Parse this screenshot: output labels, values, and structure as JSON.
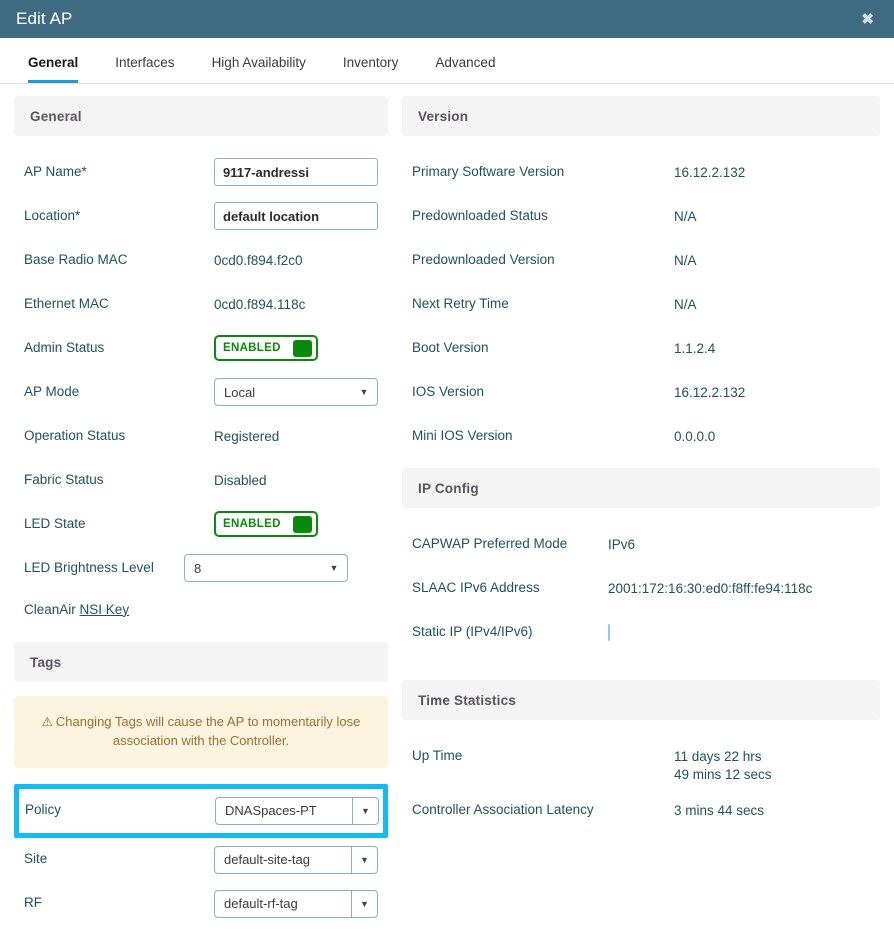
{
  "window": {
    "title": "Edit AP",
    "close_icon": "close-icon",
    "close_glyph": "✖"
  },
  "tabs": [
    {
      "label": "General",
      "active": true
    },
    {
      "label": "Interfaces",
      "active": false
    },
    {
      "label": "High Availability",
      "active": false
    },
    {
      "label": "Inventory",
      "active": false
    },
    {
      "label": "Advanced",
      "active": false
    }
  ],
  "colors": {
    "titlebar": "#3f6b82",
    "tab_active_underline": "#1b9bd8",
    "label_text": "#1f5260",
    "section_header_bg": "#f4f4f5",
    "toggle_green": "#0a8a0a",
    "highlight_cyan": "#11bdf0",
    "warning_bg": "#fdf4e0",
    "warning_text": "#9b7030"
  },
  "left": {
    "general": {
      "section_title": "General",
      "ap_name": {
        "label": "AP Name*",
        "value": "9117-andressi"
      },
      "location": {
        "label": "Location*",
        "value": "default location"
      },
      "base_radio_mac": {
        "label": "Base Radio MAC",
        "value": "0cd0.f894.f2c0"
      },
      "ethernet_mac": {
        "label": "Ethernet MAC",
        "value": "0cd0.f894.118c"
      },
      "admin_status": {
        "label": "Admin Status",
        "state": "ENABLED"
      },
      "ap_mode": {
        "label": "AP Mode",
        "value": "Local"
      },
      "operation_status": {
        "label": "Operation Status",
        "value": "Registered"
      },
      "fabric_status": {
        "label": "Fabric Status",
        "value": "Disabled"
      },
      "led_state": {
        "label": "LED State",
        "state": "ENABLED"
      },
      "led_brightness": {
        "label": "LED Brightness Level",
        "value": "8"
      },
      "cleanair": {
        "label": "CleanAir",
        "link_label": "NSI Key"
      }
    },
    "tags": {
      "section_title": "Tags",
      "warning": "Changing Tags will cause the AP to momentarily lose association with the Controller.",
      "warning_icon": "warning-triangle-icon",
      "warning_glyph": "⚠",
      "policy": {
        "label": "Policy",
        "value": "DNASpaces-PT",
        "highlighted": true
      },
      "site": {
        "label": "Site",
        "value": "default-site-tag"
      },
      "rf": {
        "label": "RF",
        "value": "default-rf-tag"
      }
    }
  },
  "right": {
    "version": {
      "section_title": "Version",
      "rows": [
        {
          "label": "Primary Software Version",
          "value": "16.12.2.132"
        },
        {
          "label": "Predownloaded Status",
          "value": "N/A"
        },
        {
          "label": "Predownloaded Version",
          "value": "N/A"
        },
        {
          "label": "Next Retry Time",
          "value": "N/A"
        },
        {
          "label": "Boot Version",
          "value": "1.1.2.4"
        },
        {
          "label": "IOS Version",
          "value": "16.12.2.132"
        },
        {
          "label": "Mini IOS Version",
          "value": "0.0.0.0"
        }
      ]
    },
    "ip_config": {
      "section_title": "IP Config",
      "capwap": {
        "label": "CAPWAP Preferred Mode",
        "value": "IPv6"
      },
      "slaac": {
        "label": "SLAAC IPv6 Address",
        "value": "2001:172:16:30:ed0:f8ff:fe94:118c"
      },
      "static_ip": {
        "label": "Static IP (IPv4/IPv6)",
        "checked": false
      }
    },
    "time_statistics": {
      "section_title": "Time Statistics",
      "up_time": {
        "label": "Up Time",
        "line1": "11 days 22 hrs",
        "line2": "49 mins 12 secs"
      },
      "latency": {
        "label": "Controller Association Latency",
        "value": "3 mins 44 secs"
      }
    }
  },
  "icons": {
    "dropdown_arrow": "▼"
  }
}
